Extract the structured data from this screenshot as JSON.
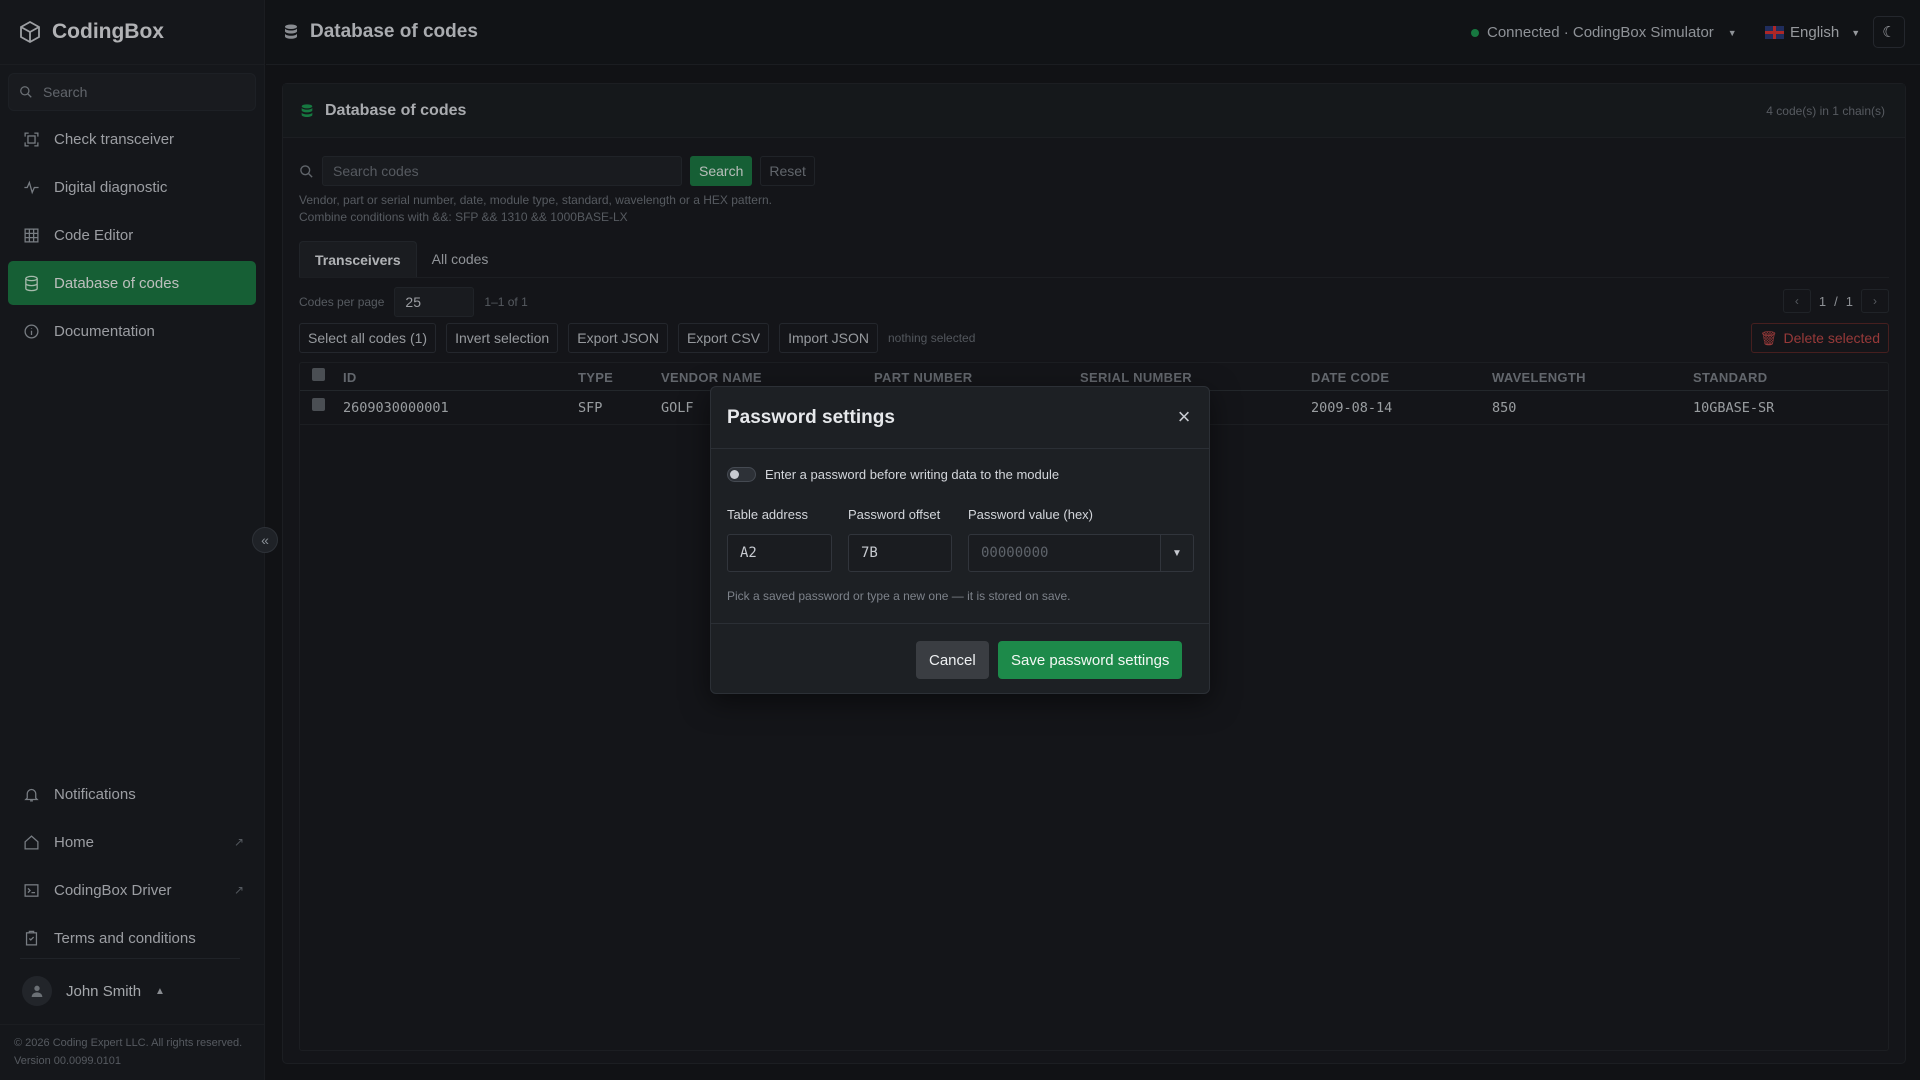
{
  "app": {
    "name": "CodingBox"
  },
  "sidebar": {
    "search_placeholder": "Search",
    "items": [
      {
        "label": "Check transceiver",
        "icon": "scan-icon"
      },
      {
        "label": "Digital diagnostic",
        "icon": "pulse-icon"
      },
      {
        "label": "Code Editor",
        "icon": "grid-icon"
      },
      {
        "label": "Database of codes",
        "icon": "database-icon",
        "active": true
      },
      {
        "label": "Documentation",
        "icon": "info-icon"
      }
    ],
    "bottom_items": [
      {
        "label": "Notifications",
        "icon": "bell-icon"
      },
      {
        "label": "Home",
        "icon": "home-icon"
      },
      {
        "label": "CodingBox Driver",
        "icon": "terminal-icon"
      },
      {
        "label": "Terms and conditions",
        "icon": "clipboard-icon"
      }
    ],
    "user": {
      "name": "John Smith"
    },
    "footer": {
      "copyright": "© 2026 Coding Expert LLC. All rights reserved.",
      "version": "Version 00.0099.0101"
    }
  },
  "topbar": {
    "title": "Database of codes",
    "connection": "Connected · CodingBox Simulator",
    "language": "English"
  },
  "panel": {
    "title": "Database of codes",
    "count": "4 code(s) in 1 chain(s)",
    "search_placeholder": "Search codes",
    "search_button": "Search",
    "reset_button": "Reset",
    "hint": "Vendor, part or serial number, date, module type, standard, wavelength or a HEX pattern. Combine conditions with &&: SFP && 1310 && 1000BASE-LX",
    "tabs": [
      "Transceivers",
      "All codes"
    ],
    "per_page_label": "Codes per page",
    "per_page_value": "25",
    "range": "1–1 of 1",
    "page": "1",
    "pages": "1",
    "actions": {
      "select_all": "Select all codes (1)",
      "invert": "Invert selection",
      "export_json": "Export JSON",
      "export_csv": "Export CSV",
      "import_json": "Import JSON",
      "nothing_selected": "nothing selected",
      "delete": "Delete selected"
    },
    "table": {
      "columns": [
        "ID",
        "TYPE",
        "VENDOR NAME",
        "PART NUMBER",
        "SERIAL NUMBER",
        "DATE CODE",
        "WAVELENGTH",
        "STANDARD"
      ],
      "rows": [
        {
          "id": "2609030000001",
          "type": "SFP",
          "vendor": "GOLF",
          "part": "",
          "serial": "",
          "date": "2009-08-14",
          "wavelength": "850",
          "standard": "10GBASE-SR"
        }
      ]
    }
  },
  "modal": {
    "title": "Password settings",
    "toggle_label": "Enter a password before writing data to the module",
    "table_address_label": "Table address",
    "table_address_value": "A2",
    "offset_label": "Password offset",
    "offset_value": "7B",
    "value_label": "Password value (hex)",
    "value_placeholder": "00000000",
    "hint": "Pick a saved password or type a new one — it is stored on save.",
    "cancel": "Cancel",
    "save": "Save password settings"
  },
  "colors": {
    "accent": "#1d7a45",
    "danger": "#c24a4a",
    "bg": "#16181c"
  }
}
